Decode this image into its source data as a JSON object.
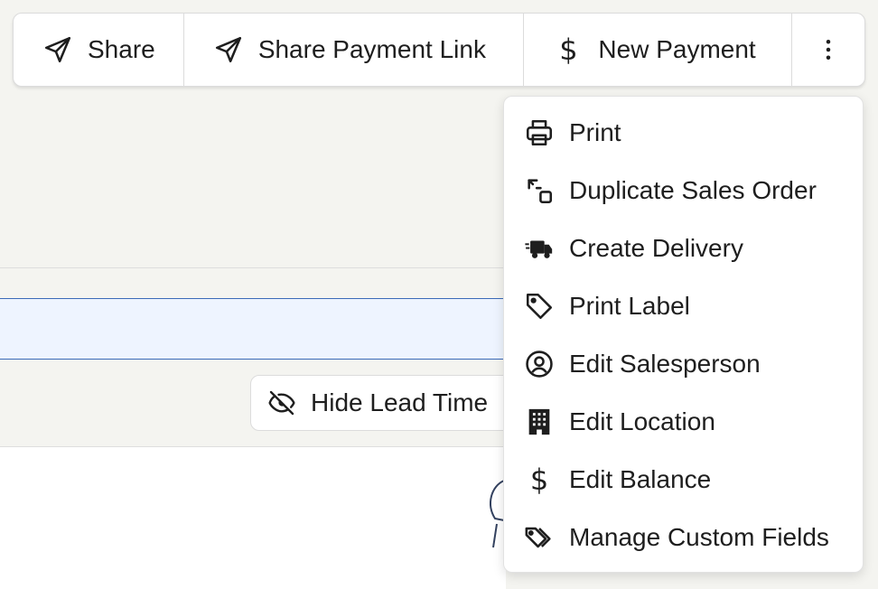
{
  "toolbar": {
    "share_label": "Share",
    "share_payment_link_label": "Share Payment Link",
    "new_payment_label": "New Payment",
    "more_icon": "more-vertical-icon"
  },
  "hide_lead_time_label": "Hide Lead Time",
  "menu": {
    "items": [
      {
        "label": "Print",
        "icon": "printer-icon"
      },
      {
        "label": "Duplicate Sales Order",
        "icon": "duplicate-icon"
      },
      {
        "label": "Create Delivery",
        "icon": "truck-icon"
      },
      {
        "label": "Print Label",
        "icon": "tag-icon"
      },
      {
        "label": "Edit Salesperson",
        "icon": "user-circle-icon"
      },
      {
        "label": "Edit Location",
        "icon": "building-icon"
      },
      {
        "label": "Edit Balance",
        "icon": "dollar-icon"
      },
      {
        "label": "Manage Custom Fields",
        "icon": "tags-icon"
      }
    ]
  },
  "colors": {
    "background": "#f4f4f0",
    "band": "#eef4ff",
    "band_border": "#3b6ab8"
  }
}
